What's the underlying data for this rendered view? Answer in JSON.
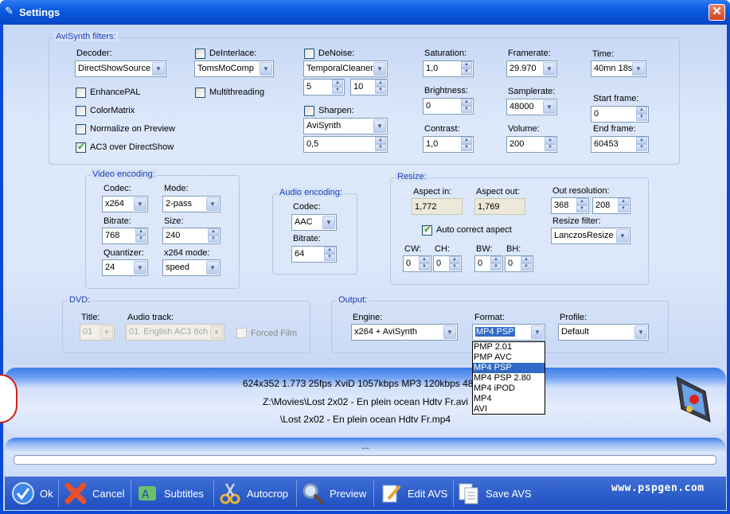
{
  "window": {
    "title": "Settings",
    "close_glyph": "✕"
  },
  "avisynth": {
    "group_title": "AviSynth filters:",
    "decoder_label": "Decoder:",
    "decoder_value": "DirectShowSource",
    "enhancepal": "EnhancePAL",
    "colormatrix": "ColorMatrix",
    "normalize": "Normalize on Preview",
    "ac3": "AC3 over DirectShow",
    "deinterlace_label": "DeInterlace:",
    "deinterlace_value": "TomsMoComp",
    "multithreading": "Multithreading",
    "denoise_label": "DeNoise:",
    "denoise_value": "TemporalCleaner",
    "denoise_p1": "5",
    "denoise_p2": "10",
    "sharpen_label": "Sharpen:",
    "sharpen_value": "AviSynth",
    "sharpen_amount": "0,5",
    "saturation_label": "Saturation:",
    "saturation_value": "1,0",
    "brightness_label": "Brightness:",
    "brightness_value": "0",
    "contrast_label": "Contrast:",
    "contrast_value": "1,0",
    "framerate_label": "Framerate:",
    "framerate_value": "29.970",
    "samplerate_label": "Samplerate:",
    "samplerate_value": "48000",
    "volume_label": "Volume:",
    "volume_value": "200",
    "time_label": "Time:",
    "time_value": "40mn 18s",
    "start_label": "Start frame:",
    "start_value": "0",
    "end_label": "End frame:",
    "end_value": "60453"
  },
  "video": {
    "group_title": "Video encoding:",
    "codec_label": "Codec:",
    "codec_value": "x264",
    "mode_label": "Mode:",
    "mode_value": "2-pass",
    "bitrate_label": "Bitrate:",
    "bitrate_value": "768",
    "size_label": "Size:",
    "size_value": "240",
    "quantizer_label": "Quantizer:",
    "quantizer_value": "24",
    "x264mode_label": "x264 mode:",
    "x264mode_value": "speed"
  },
  "audio": {
    "group_title": "Audio encoding:",
    "codec_label": "Codec:",
    "codec_value": "AAC",
    "bitrate_label": "Bitrate:",
    "bitrate_value": "64"
  },
  "resize": {
    "group_title": "Resize:",
    "aspect_in_label": "Aspect in:",
    "aspect_in_value": "1,772",
    "aspect_out_label": "Aspect out:",
    "aspect_out_value": "1,769",
    "out_res_label": "Out resolution:",
    "out_w": "368",
    "out_h": "208",
    "filter_label": "Resize filter:",
    "filter_value": "LanczosResize",
    "auto_correct": "Auto correct aspect",
    "cw_label": "CW:",
    "cw": "0",
    "ch_label": "CH:",
    "ch": "0",
    "bw_label": "BW:",
    "bw": "0",
    "bh_label": "BH:",
    "bh": "0"
  },
  "dvd": {
    "group_title": "DVD:",
    "title_label": "Title:",
    "title_value": "01",
    "audio_label": "Audio track:",
    "audio_value": "01. English AC3 6ch",
    "forced": "Forced Film"
  },
  "output": {
    "group_title": "Output:",
    "engine_label": "Engine:",
    "engine_value": "x264 + AviSynth",
    "format_label": "Format:",
    "format_value": "MP4 PSP",
    "profile_label": "Profile:",
    "profile_value": "Default",
    "format_options": [
      "PMP 2.01",
      "PMP AVC",
      "MP4 PSP",
      "MP4 PSP 2.80",
      "MP4 iPOD",
      "MP4",
      "AVI"
    ]
  },
  "info": {
    "line1": "624x352  1.773  25fps  XviD  1057kbps  MP3  120kbps  48khz",
    "line2": "Z:\\Movies\\Lost 2x02 - En plein ocean Hdtv Fr.avi",
    "line3": "\\Lost 2x02 - En plein ocean Hdtv Fr.mp4"
  },
  "progress": {
    "status": "...",
    "fraction": 0
  },
  "toolbar": {
    "ok": "Ok",
    "cancel": "Cancel",
    "subtitles": "Subtitles",
    "autocrop": "Autocrop",
    "preview": "Preview",
    "edit_avs": "Edit AVS",
    "save_avs": "Save AVS",
    "website": "www.pspgen.com"
  }
}
